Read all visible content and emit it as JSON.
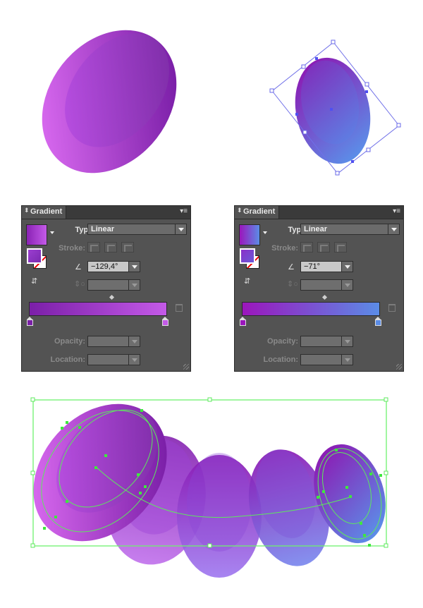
{
  "artwork": {
    "top_left_shape": {
      "name": "egg-shape-pink-purple",
      "gradient_colors": [
        "#7b1fa8",
        "#d768f0"
      ]
    },
    "top_right_shape": {
      "name": "egg-shape-purple-blue-selected",
      "gradient_colors": [
        "#8a1ab0",
        "#5d8be8"
      ],
      "selection_color": "#6f6fe8"
    },
    "bottom_blend": {
      "name": "blended-egg-shapes",
      "selection_color": "#5af05a",
      "shape_count": 5,
      "shape_colors": [
        "#a13fd8",
        "#9d48e0",
        "#9050e0",
        "#7d5ce0",
        "#6a6ee8"
      ]
    }
  },
  "panels": [
    {
      "title": "Gradient",
      "menu_icon": "panel-menu-icon",
      "swatch_colors": [
        "#8a22b5",
        "#c45ae8"
      ],
      "type_label": "Type:",
      "type_value": "Linear",
      "stroke_label": "Stroke:",
      "angle_value": "−129,4°",
      "aspect_value": "",
      "opacity_label": "Opacity:",
      "opacity_value": "",
      "location_label": "Location:",
      "location_value": "",
      "ramp_stops": [
        {
          "color": "#7b1fa8",
          "location": 0
        },
        {
          "color": "#c45ae8",
          "location": 100
        }
      ]
    },
    {
      "title": "Gradient",
      "menu_icon": "panel-menu-icon",
      "swatch_colors": [
        "#9b16bc",
        "#5b8ce6"
      ],
      "type_label": "Type:",
      "type_value": "Linear",
      "stroke_label": "Stroke:",
      "angle_value": "−71°",
      "aspect_value": "",
      "opacity_label": "Opacity:",
      "opacity_value": "",
      "location_label": "Location:",
      "location_value": "",
      "ramp_stops": [
        {
          "color": "#9b16bc",
          "location": 0
        },
        {
          "color": "#5b8ce6",
          "location": 100
        }
      ]
    }
  ]
}
